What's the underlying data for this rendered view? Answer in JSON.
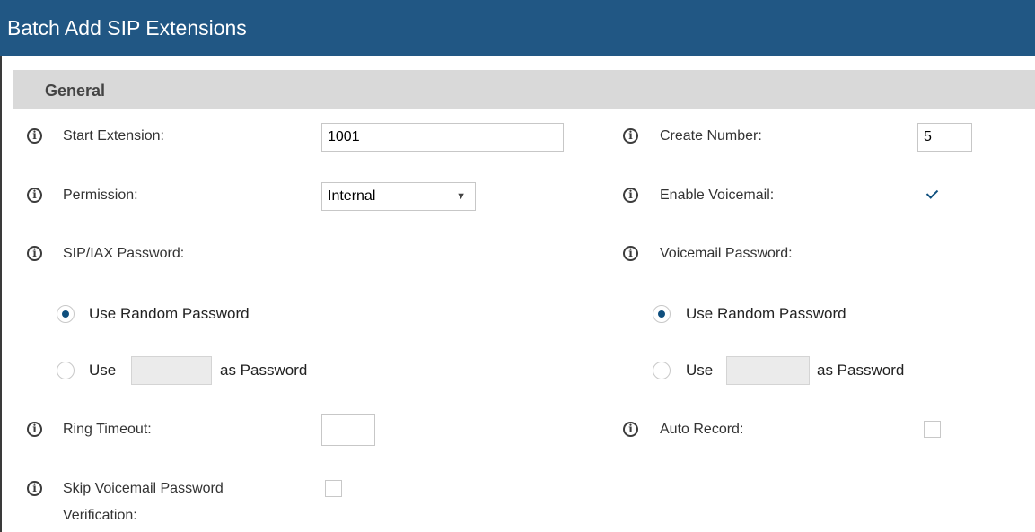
{
  "window": {
    "title": "Batch Add SIP Extensions"
  },
  "section": {
    "title": "General"
  },
  "icons": {
    "info": "info-icon",
    "info_glyph": "i",
    "caret_glyph": "▼"
  },
  "colors": {
    "titlebar": "#215784",
    "section": "#d9d9d9",
    "accent": "#0f4f7e"
  },
  "left": {
    "start_extension": {
      "label": "Start Extension:",
      "value": "1001"
    },
    "permission": {
      "label": "Permission:",
      "value": "Internal"
    },
    "sip_password": {
      "label": "SIP/IAX Password:",
      "option_random": "Use Random Password",
      "option_custom_prefix": "Use",
      "option_custom_suffix": "as Password",
      "custom_value": "",
      "selected": "random"
    },
    "ring_timeout": {
      "label": "Ring Timeout:",
      "value": ""
    },
    "skip_vm_verification": {
      "label_line1": "Skip Voicemail Password",
      "label_line2": "Verification:",
      "checked": false
    }
  },
  "right": {
    "create_number": {
      "label": "Create Number:",
      "value": "5"
    },
    "enable_voicemail": {
      "label": "Enable Voicemail:",
      "checked": true
    },
    "voicemail_password": {
      "label": "Voicemail Password:",
      "option_random": "Use Random Password",
      "option_custom_prefix": "Use",
      "option_custom_suffix": "as Password",
      "custom_value": "",
      "selected": "random"
    },
    "auto_record": {
      "label": "Auto Record:",
      "checked": false
    }
  }
}
